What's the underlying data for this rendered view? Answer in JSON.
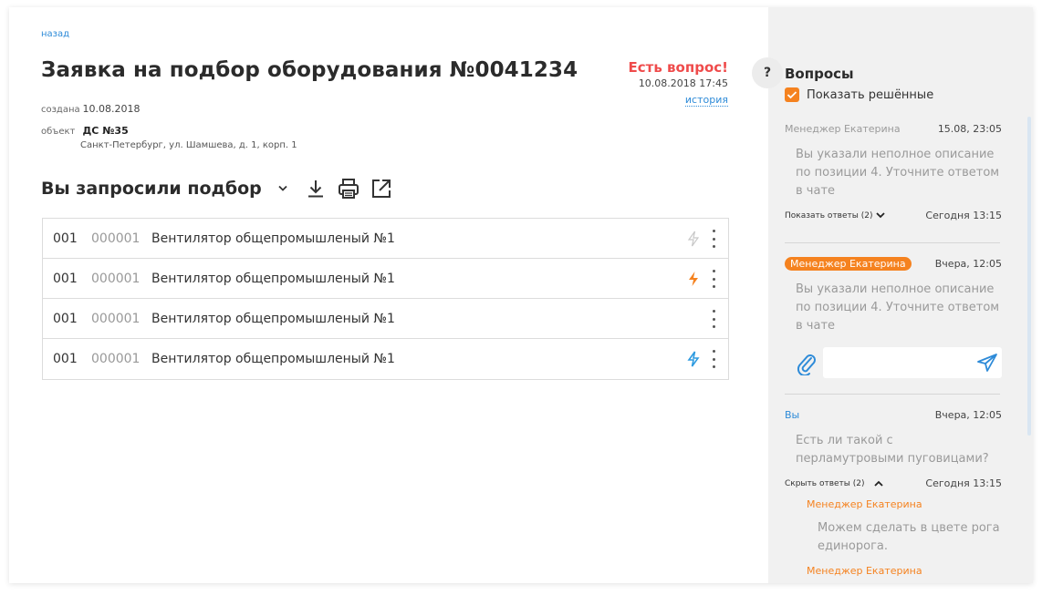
{
  "main": {
    "back_link": "назад",
    "title": "Заявка на подбор оборудования №0041234",
    "status": {
      "text": "Есть вопрос!",
      "date": "10.08.2018 17:45",
      "history": "история"
    },
    "created_label": "создана",
    "created_value": "10.08.2018",
    "object_label": "объект",
    "object_name": "ДС №35",
    "object_address": "Санкт-Петербург, ул. Шамшева, д. 1, корп. 1",
    "section_title": "Вы запросили подбор",
    "tools": [
      "chevron-down-icon",
      "download-icon",
      "print-icon",
      "external-link-icon"
    ],
    "items": [
      {
        "qty": "001",
        "code": "000001",
        "name": "Вентилятор общепромышленый №1",
        "bolt": "gray"
      },
      {
        "qty": "001",
        "code": "000001",
        "name": "Вентилятор общепромышленый №1",
        "bolt": "orange"
      },
      {
        "qty": "001",
        "code": "000001",
        "name": "Вентилятор общепромышленый №1",
        "bolt": "none"
      },
      {
        "qty": "001",
        "code": "000001",
        "name": "Вентилятор общепромышленый №1",
        "bolt": "blue"
      }
    ]
  },
  "sidebar": {
    "title": "Вопросы",
    "show_solved": "Показать решённые",
    "threads": [
      {
        "author": "Менеджер Екатерина",
        "time": "15.08, 23:05",
        "message": "Вы указали неполное описание по позиции 4. Уточните ответом в чате",
        "toggle": "Показать ответы (2)",
        "foot_time": "Сегодня 13:15"
      },
      {
        "author": "Менеджер Екатерина",
        "time": "Вчера, 12:05",
        "message": "Вы указали неполное описание по позиции 4. Уточните ответом в чате"
      },
      {
        "author": "Вы",
        "time": "Вчера, 12:05",
        "message": "Есть ли такой с перламутровыми пуговицами?",
        "toggle": "Скрыть ответы (2)",
        "foot_time": "Сегодня 13:15",
        "replies": [
          {
            "author": "Менеджер Екатерина",
            "message": "Можем сделать в цвете рога единорога."
          },
          {
            "author": "Менеджер Екатерина"
          }
        ]
      }
    ]
  },
  "colors": {
    "accent_orange": "#f5821f",
    "link_blue": "#2e8bd8",
    "alert_red": "#ef4b4b"
  }
}
